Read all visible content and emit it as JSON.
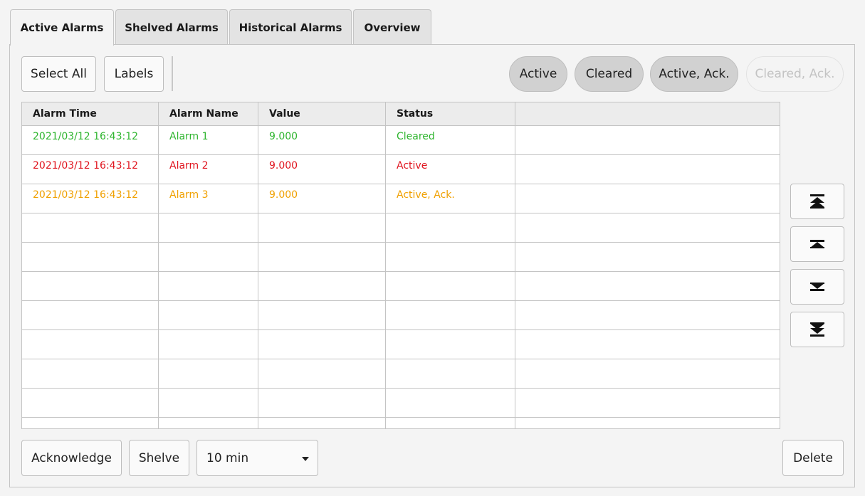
{
  "tabs": [
    {
      "label": "Active Alarms",
      "active": true
    },
    {
      "label": "Shelved Alarms",
      "active": false
    },
    {
      "label": "Historical Alarms",
      "active": false
    },
    {
      "label": "Overview",
      "active": false
    }
  ],
  "toolbar": {
    "select_all_label": "Select All",
    "labels_label": "Labels"
  },
  "filters": [
    {
      "label": "Active",
      "enabled": true
    },
    {
      "label": "Cleared",
      "enabled": true
    },
    {
      "label": "Active, Ack.",
      "enabled": true
    },
    {
      "label": "Cleared, Ack.",
      "enabled": false
    }
  ],
  "table": {
    "columns": [
      "Alarm Time",
      "Alarm Name",
      "Value",
      "Status",
      ""
    ],
    "rows": [
      {
        "time": "2021/03/12 16:43:12",
        "name": "Alarm 1",
        "value": "9.000",
        "status": "Cleared",
        "color": "#2fb52f"
      },
      {
        "time": "2021/03/12 16:43:12",
        "name": "Alarm 2",
        "value": "9.000",
        "status": "Active",
        "color": "#e0141e"
      },
      {
        "time": "2021/03/12 16:43:12",
        "name": "Alarm 3",
        "value": "9.000",
        "status": "Active, Ack.",
        "color": "#f0a000"
      }
    ],
    "empty_row_count": 8
  },
  "nav": [
    "scroll-to-top-icon",
    "scroll-up-icon",
    "scroll-down-icon",
    "scroll-to-bottom-icon"
  ],
  "footer": {
    "acknowledge_label": "Acknowledge",
    "shelve_label": "Shelve",
    "shelve_duration": "10 min",
    "delete_label": "Delete"
  }
}
